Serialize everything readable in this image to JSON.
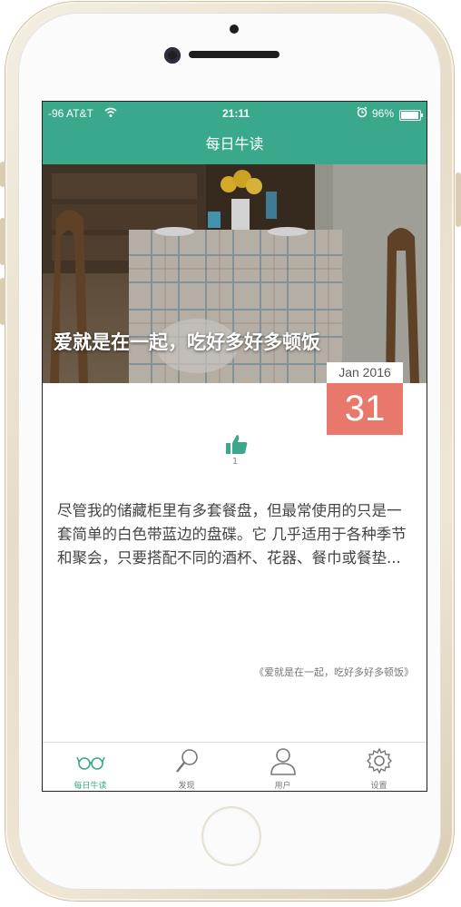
{
  "status_bar": {
    "carrier": "-96 AT&T",
    "time": "21:11",
    "battery_percent": "96%",
    "battery_level": 0.96
  },
  "nav": {
    "title": "每日牛读"
  },
  "article": {
    "title": "爱就是在一起，吃好多好多顿饭",
    "date_month": "Jan 2016",
    "date_day": "31",
    "like_count": "1",
    "excerpt": "尽管我的储藏柜里有多套餐盘，但最常使用的只是一套简单的白色带蓝边的盘碟。它 几乎适用于各种季节和聚会，只要搭配不同的酒杯、花器、餐巾或餐垫...",
    "source": "《爱就是在一起，吃好多好多顿饭》"
  },
  "tabs": [
    {
      "label": "每日牛读",
      "icon": "glasses-icon",
      "active": true
    },
    {
      "label": "发现",
      "icon": "magnifier-icon",
      "active": false
    },
    {
      "label": "用户",
      "icon": "user-icon",
      "active": false
    },
    {
      "label": "设置",
      "icon": "gear-icon",
      "active": false
    }
  ],
  "colors": {
    "accent": "#3aa98b",
    "date_badge": "#e8786c"
  }
}
